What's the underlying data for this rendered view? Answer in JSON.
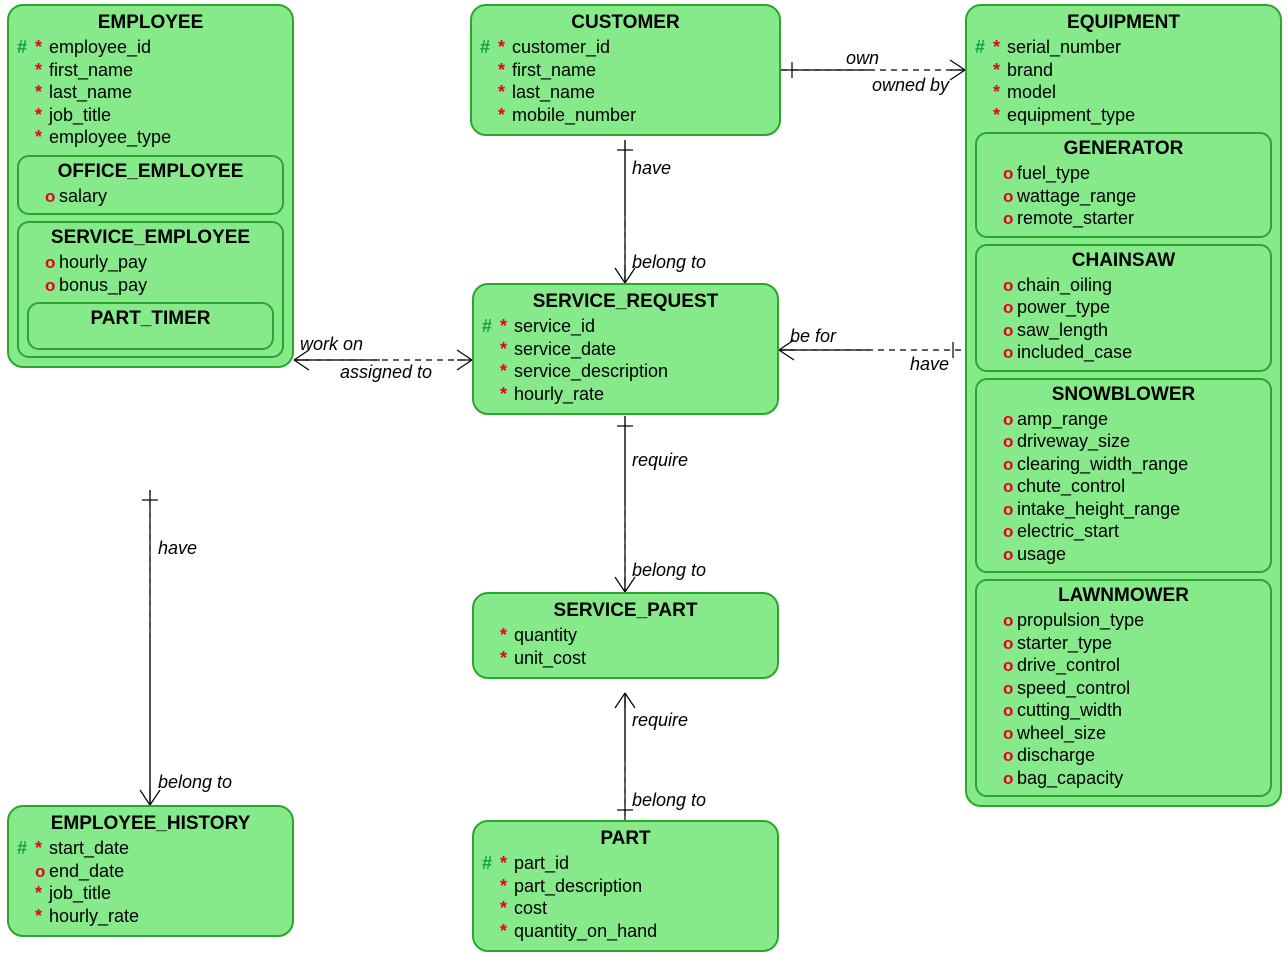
{
  "entities": {
    "employee": {
      "title": "EMPLOYEE",
      "attrs": [
        {
          "key": "#",
          "mand": "*",
          "name": "employee_id"
        },
        {
          "key": "",
          "mand": "*",
          "name": "first_name"
        },
        {
          "key": "",
          "mand": "*",
          "name": "last_name"
        },
        {
          "key": "",
          "mand": "*",
          "name": "job_title"
        },
        {
          "key": "",
          "mand": "*",
          "name": "employee_type"
        }
      ],
      "sub_office": {
        "title": "OFFICE_EMPLOYEE",
        "attrs": [
          {
            "opt": "o",
            "name": "salary"
          }
        ]
      },
      "sub_service": {
        "title": "SERVICE_EMPLOYEE",
        "attrs": [
          {
            "opt": "o",
            "name": "hourly_pay"
          },
          {
            "opt": "o",
            "name": "bonus_pay"
          }
        ],
        "sub_part_timer": {
          "title": "PART_TIMER"
        }
      }
    },
    "customer": {
      "title": "CUSTOMER",
      "attrs": [
        {
          "key": "#",
          "mand": "*",
          "name": "customer_id"
        },
        {
          "key": "",
          "mand": "*",
          "name": "first_name"
        },
        {
          "key": "",
          "mand": "*",
          "name": "last_name"
        },
        {
          "key": "",
          "mand": "*",
          "name": "mobile_number"
        }
      ]
    },
    "equipment": {
      "title": "EQUIPMENT",
      "attrs": [
        {
          "key": "#",
          "mand": "*",
          "name": "serial_number"
        },
        {
          "key": "",
          "mand": "*",
          "name": "brand"
        },
        {
          "key": "",
          "mand": "*",
          "name": "model"
        },
        {
          "key": "",
          "mand": "*",
          "name": "equipment_type"
        }
      ],
      "sub_generator": {
        "title": "GENERATOR",
        "attrs": [
          {
            "opt": "o",
            "name": "fuel_type"
          },
          {
            "opt": "o",
            "name": "wattage_range"
          },
          {
            "opt": "o",
            "name": "remote_starter"
          }
        ]
      },
      "sub_chainsaw": {
        "title": "CHAINSAW",
        "attrs": [
          {
            "opt": "o",
            "name": "chain_oiling"
          },
          {
            "opt": "o",
            "name": "power_type"
          },
          {
            "opt": "o",
            "name": "saw_length"
          },
          {
            "opt": "o",
            "name": "included_case"
          }
        ]
      },
      "sub_snowblower": {
        "title": "SNOWBLOWER",
        "attrs": [
          {
            "opt": "o",
            "name": "amp_range"
          },
          {
            "opt": "o",
            "name": "driveway_size"
          },
          {
            "opt": "o",
            "name": "clearing_width_range"
          },
          {
            "opt": "o",
            "name": "chute_control"
          },
          {
            "opt": "o",
            "name": "intake_height_range"
          },
          {
            "opt": "o",
            "name": "electric_start"
          },
          {
            "opt": "o",
            "name": "usage"
          }
        ]
      },
      "sub_lawnmower": {
        "title": "LAWNMOWER",
        "attrs": [
          {
            "opt": "o",
            "name": "propulsion_type"
          },
          {
            "opt": "o",
            "name": "starter_type"
          },
          {
            "opt": "o",
            "name": "drive_control"
          },
          {
            "opt": "o",
            "name": "speed_control"
          },
          {
            "opt": "o",
            "name": "cutting_width"
          },
          {
            "opt": "o",
            "name": "wheel_size"
          },
          {
            "opt": "o",
            "name": "discharge"
          },
          {
            "opt": "o",
            "name": "bag_capacity"
          }
        ]
      }
    },
    "service_request": {
      "title": "SERVICE_REQUEST",
      "attrs": [
        {
          "key": "#",
          "mand": "*",
          "name": "service_id"
        },
        {
          "key": "",
          "mand": "*",
          "name": "service_date"
        },
        {
          "key": "",
          "mand": "*",
          "name": "service_description"
        },
        {
          "key": "",
          "mand": "*",
          "name": "hourly_rate"
        }
      ]
    },
    "service_part": {
      "title": "SERVICE_PART",
      "attrs": [
        {
          "key": "",
          "mand": "*",
          "name": "quantity"
        },
        {
          "key": "",
          "mand": "*",
          "name": "unit_cost"
        }
      ]
    },
    "part": {
      "title": "PART",
      "attrs": [
        {
          "key": "#",
          "mand": "*",
          "name": "part_id"
        },
        {
          "key": "",
          "mand": "*",
          "name": "part_description"
        },
        {
          "key": "",
          "mand": "*",
          "name": "cost"
        },
        {
          "key": "",
          "mand": "*",
          "name": "quantity_on_hand"
        }
      ]
    },
    "employee_history": {
      "title": "EMPLOYEE_HISTORY",
      "attrs": [
        {
          "key": "#",
          "mand": "*",
          "name": "start_date"
        },
        {
          "key": "",
          "opt": "o",
          "name": "end_date"
        },
        {
          "key": "",
          "mand": "*",
          "name": "job_title"
        },
        {
          "key": "",
          "mand": "*",
          "name": "hourly_rate"
        }
      ]
    }
  },
  "labels": {
    "own": "own",
    "owned_by": "owned by",
    "have1": "have",
    "belong_to1": "belong to",
    "work_on": "work on",
    "assigned_to": "assigned to",
    "be_for": "be for",
    "have2": "have",
    "require1": "require",
    "belong_to2": "belong to",
    "require2": "require",
    "belong_to3": "belong to",
    "have3": "have",
    "belong_to4": "belong to"
  }
}
